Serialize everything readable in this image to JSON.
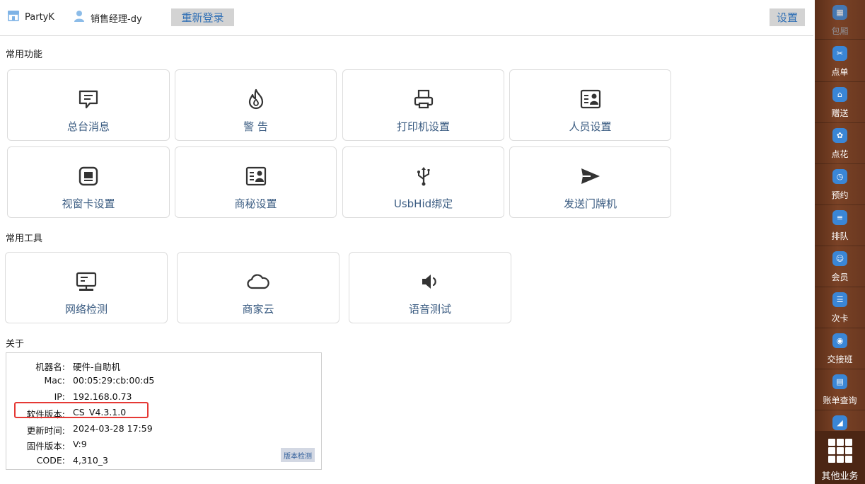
{
  "topbar": {
    "store_name": "PartyK",
    "user_name": "销售经理-dy",
    "relogin_label": "重新登录",
    "settings_label": "设置"
  },
  "sections": {
    "common_functions": "常用功能",
    "common_tools": "常用工具",
    "about": "关于"
  },
  "functions": [
    {
      "label": "总台消息",
      "icon": "message-icon"
    },
    {
      "label": "警 告",
      "icon": "fire-icon"
    },
    {
      "label": "打印机设置",
      "icon": "printer-icon"
    },
    {
      "label": "人员设置",
      "icon": "id-card-icon"
    },
    {
      "label": "视窗卡设置",
      "icon": "window-card-icon"
    },
    {
      "label": "商秘设置",
      "icon": "id-card-icon"
    },
    {
      "label": "UsbHid绑定",
      "icon": "usb-icon"
    },
    {
      "label": "发送门牌机",
      "icon": "send-icon"
    }
  ],
  "tools": [
    {
      "label": "网络检测",
      "icon": "monitor-icon"
    },
    {
      "label": "商家云",
      "icon": "cloud-icon"
    },
    {
      "label": "语音测试",
      "icon": "speaker-icon"
    }
  ],
  "about": {
    "rows": [
      {
        "key": "机器名:",
        "value": "硬件-自助机"
      },
      {
        "key": "Mac:",
        "value": "00:05:29:cb:00:d5"
      },
      {
        "key": "IP:",
        "value": "192.168.0.73"
      },
      {
        "key": "软件版本:",
        "value": "CS_V4.3.1.0"
      },
      {
        "key": "更新时间:",
        "value": "2024-03-28 17:59"
      },
      {
        "key": "固件版本:",
        "value": "V:9"
      },
      {
        "key": "CODE:",
        "value": "4,310_3"
      }
    ],
    "check_version_label": "版本检测",
    "highlight_color": "#e53935"
  },
  "sidebar": {
    "items": [
      {
        "label": "包厢",
        "icon": "rooms-icon",
        "glyph": "▦"
      },
      {
        "label": "点单",
        "icon": "order-icon",
        "glyph": "✂"
      },
      {
        "label": "赠送",
        "icon": "gift-icon",
        "glyph": "⌂"
      },
      {
        "label": "点花",
        "icon": "flower-icon",
        "glyph": "✿"
      },
      {
        "label": "预约",
        "icon": "reserve-icon",
        "glyph": "◷"
      },
      {
        "label": "排队",
        "icon": "queue-icon",
        "glyph": "≡"
      },
      {
        "label": "会员",
        "icon": "member-icon",
        "glyph": "☺"
      },
      {
        "label": "次卡",
        "icon": "times-card-icon",
        "glyph": "☰"
      },
      {
        "label": "交接班",
        "icon": "shift-icon",
        "glyph": "◉"
      },
      {
        "label": "账单查询",
        "icon": "bill-icon",
        "glyph": "▤"
      },
      {
        "label": "",
        "icon": "chart-icon",
        "glyph": "◢"
      }
    ],
    "other_label": "其他业务",
    "bg_color": "#6a3820",
    "icon_color": "#3a86d6"
  }
}
